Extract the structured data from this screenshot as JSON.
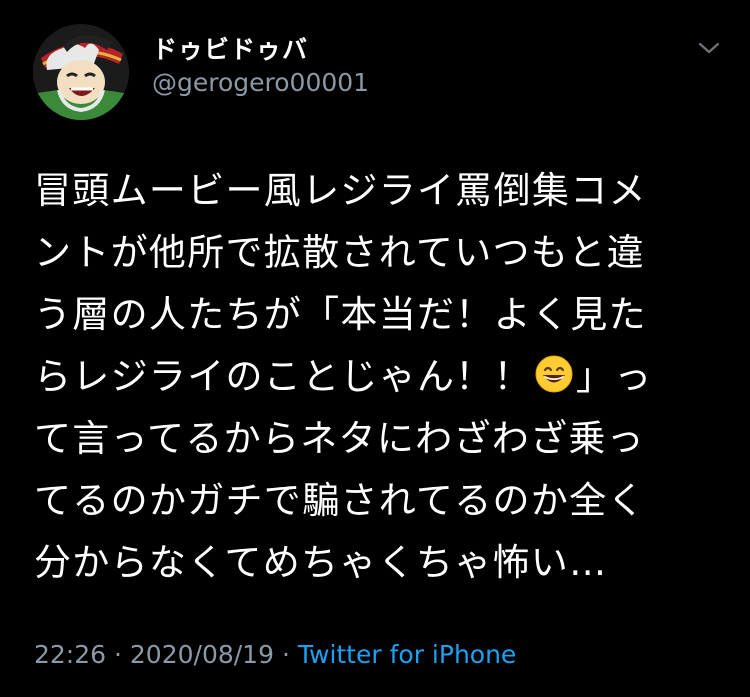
{
  "author": {
    "display_name": "ドゥビドゥバ",
    "handle": "@gerogero00001",
    "avatar_icon": "cartoon-pirate-captain-avatar"
  },
  "menu": {
    "icon": "chevron-down-icon"
  },
  "tweet": {
    "lines": [
      "冒頭ムービー風レジライ罵倒集コメ",
      "ントが他所で拡散されていつもと違",
      "う層の人たちが「本当だ！よく見た",
      "らレジライのことじゃん！！",
      "」っ",
      "て言ってるからネタにわざわざ乗っ",
      "てるのかガチで騙されてるのか全く",
      "分からなくてめちゃくちゃ怖い…"
    ],
    "emoji": "grinning-face-with-smiling-eyes-emoji"
  },
  "meta": {
    "time": "22:26",
    "separator": "·",
    "date": "2020/08/19",
    "source": "Twitter for iPhone"
  },
  "colors": {
    "background": "#000000",
    "text_primary": "#ffffff",
    "text_secondary": "#8b98a5",
    "accent": "#1da1f2"
  }
}
